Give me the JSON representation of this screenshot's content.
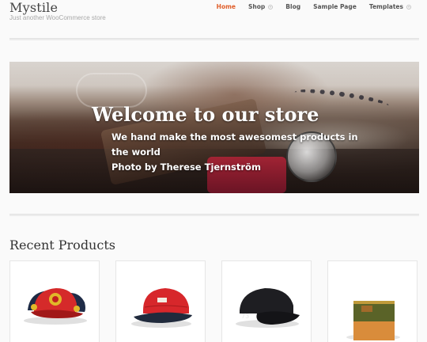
{
  "header": {
    "site_title": "Mystile",
    "tagline": "Just another WooCommerce store"
  },
  "nav": {
    "items": [
      {
        "label": "Home",
        "active": true,
        "has_dropdown": false
      },
      {
        "label": "Shop",
        "active": false,
        "has_dropdown": true
      },
      {
        "label": "Blog",
        "active": false,
        "has_dropdown": false
      },
      {
        "label": "Sample Page",
        "active": false,
        "has_dropdown": false
      },
      {
        "label": "Templates",
        "active": false,
        "has_dropdown": true
      }
    ]
  },
  "hero": {
    "title": "Welcome to our store",
    "lines": [
      "We hand make the most awesomest products in",
      "the world",
      "Photo by Therese Tjernström"
    ]
  },
  "recent_products": {
    "title": "Recent Products",
    "products": [
      {
        "icon": "red-cap-icon"
      },
      {
        "icon": "red-cap-icon"
      },
      {
        "icon": "black-cap-icon"
      },
      {
        "icon": "wallet-icon"
      }
    ]
  },
  "colors": {
    "accent": "#e05f2b",
    "nav_text": "#555555",
    "tagline": "#a8a8a8",
    "page_bg": "#fafafa"
  }
}
